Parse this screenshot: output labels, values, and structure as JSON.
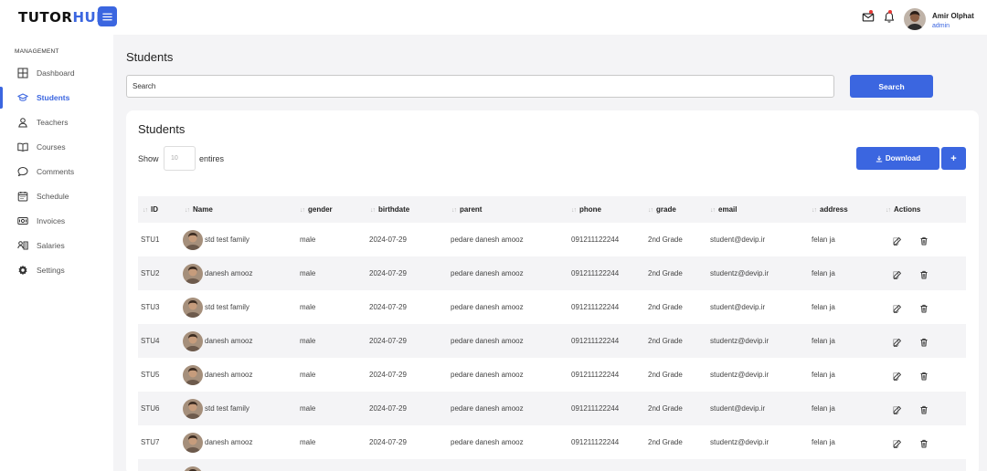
{
  "brand": {
    "logo_main": "TUTOR",
    "logo_accent": "HUB"
  },
  "header": {
    "user_name": "Amir Olphat",
    "user_role": "admin",
    "icons": [
      "menu-icon",
      "mail-icon",
      "bell-icon"
    ]
  },
  "sidebar": {
    "section": "MANAGEMENT",
    "items": [
      {
        "label": "Dashboard",
        "icon": "dashboard-icon",
        "active": false
      },
      {
        "label": "Students",
        "icon": "graduation-cap-icon",
        "active": true
      },
      {
        "label": "Teachers",
        "icon": "user-icon",
        "active": false
      },
      {
        "label": "Courses",
        "icon": "book-icon",
        "active": false
      },
      {
        "label": "Comments",
        "icon": "comment-icon",
        "active": false
      },
      {
        "label": "Schedule",
        "icon": "calendar-icon",
        "active": false
      },
      {
        "label": "Invoices",
        "icon": "invoice-icon",
        "active": false
      },
      {
        "label": "Salaries",
        "icon": "salary-icon",
        "active": false
      },
      {
        "label": "Settings",
        "icon": "gear-icon",
        "active": false
      }
    ]
  },
  "main": {
    "page_title": "Students",
    "search_placeholder": "Search",
    "search_button": "Search",
    "card_title": "Students",
    "show_label": "Show",
    "show_placeholder": "10",
    "entries_label": "entires",
    "download_label": "Download",
    "add_label": "+"
  },
  "table": {
    "columns": [
      "ID",
      "Name",
      "gender",
      "birthdate",
      "parent",
      "phone",
      "grade",
      "email",
      "address",
      "Actions"
    ],
    "rows": [
      {
        "id": "STU1",
        "name": "std test family",
        "gender": "male",
        "birthdate": "2024-07-29",
        "parent": "pedare danesh amooz",
        "phone": "091211122244",
        "grade": "2nd Grade",
        "email": "student@devip.ir",
        "address": "felan ja"
      },
      {
        "id": "STU2",
        "name": "danesh amooz",
        "gender": "male",
        "birthdate": "2024-07-29",
        "parent": "pedare danesh amooz",
        "phone": "091211122244",
        "grade": "2nd Grade",
        "email": "studentz@devip.ir",
        "address": "felan ja"
      },
      {
        "id": "STU3",
        "name": "std test family",
        "gender": "male",
        "birthdate": "2024-07-29",
        "parent": "pedare danesh amooz",
        "phone": "091211122244",
        "grade": "2nd Grade",
        "email": "student@devip.ir",
        "address": "felan ja"
      },
      {
        "id": "STU4",
        "name": "danesh amooz",
        "gender": "male",
        "birthdate": "2024-07-29",
        "parent": "pedare danesh amooz",
        "phone": "091211122244",
        "grade": "2nd Grade",
        "email": "studentz@devip.ir",
        "address": "felan ja"
      },
      {
        "id": "STU5",
        "name": "danesh amooz",
        "gender": "male",
        "birthdate": "2024-07-29",
        "parent": "pedare danesh amooz",
        "phone": "091211122244",
        "grade": "2nd Grade",
        "email": "studentz@devip.ir",
        "address": "felan ja"
      },
      {
        "id": "STU6",
        "name": "std test family",
        "gender": "male",
        "birthdate": "2024-07-29",
        "parent": "pedare danesh amooz",
        "phone": "091211122244",
        "grade": "2nd Grade",
        "email": "student@devip.ir",
        "address": "felan ja"
      },
      {
        "id": "STU7",
        "name": "danesh amooz",
        "gender": "male",
        "birthdate": "2024-07-29",
        "parent": "pedare danesh amooz",
        "phone": "091211122244",
        "grade": "2nd Grade",
        "email": "studentz@devip.ir",
        "address": "felan ja"
      }
    ]
  },
  "colors": {
    "accent": "#3b66e0",
    "background": "#f4f4f6",
    "row_alt": "#f4f4f6",
    "notification": "#e53935"
  }
}
